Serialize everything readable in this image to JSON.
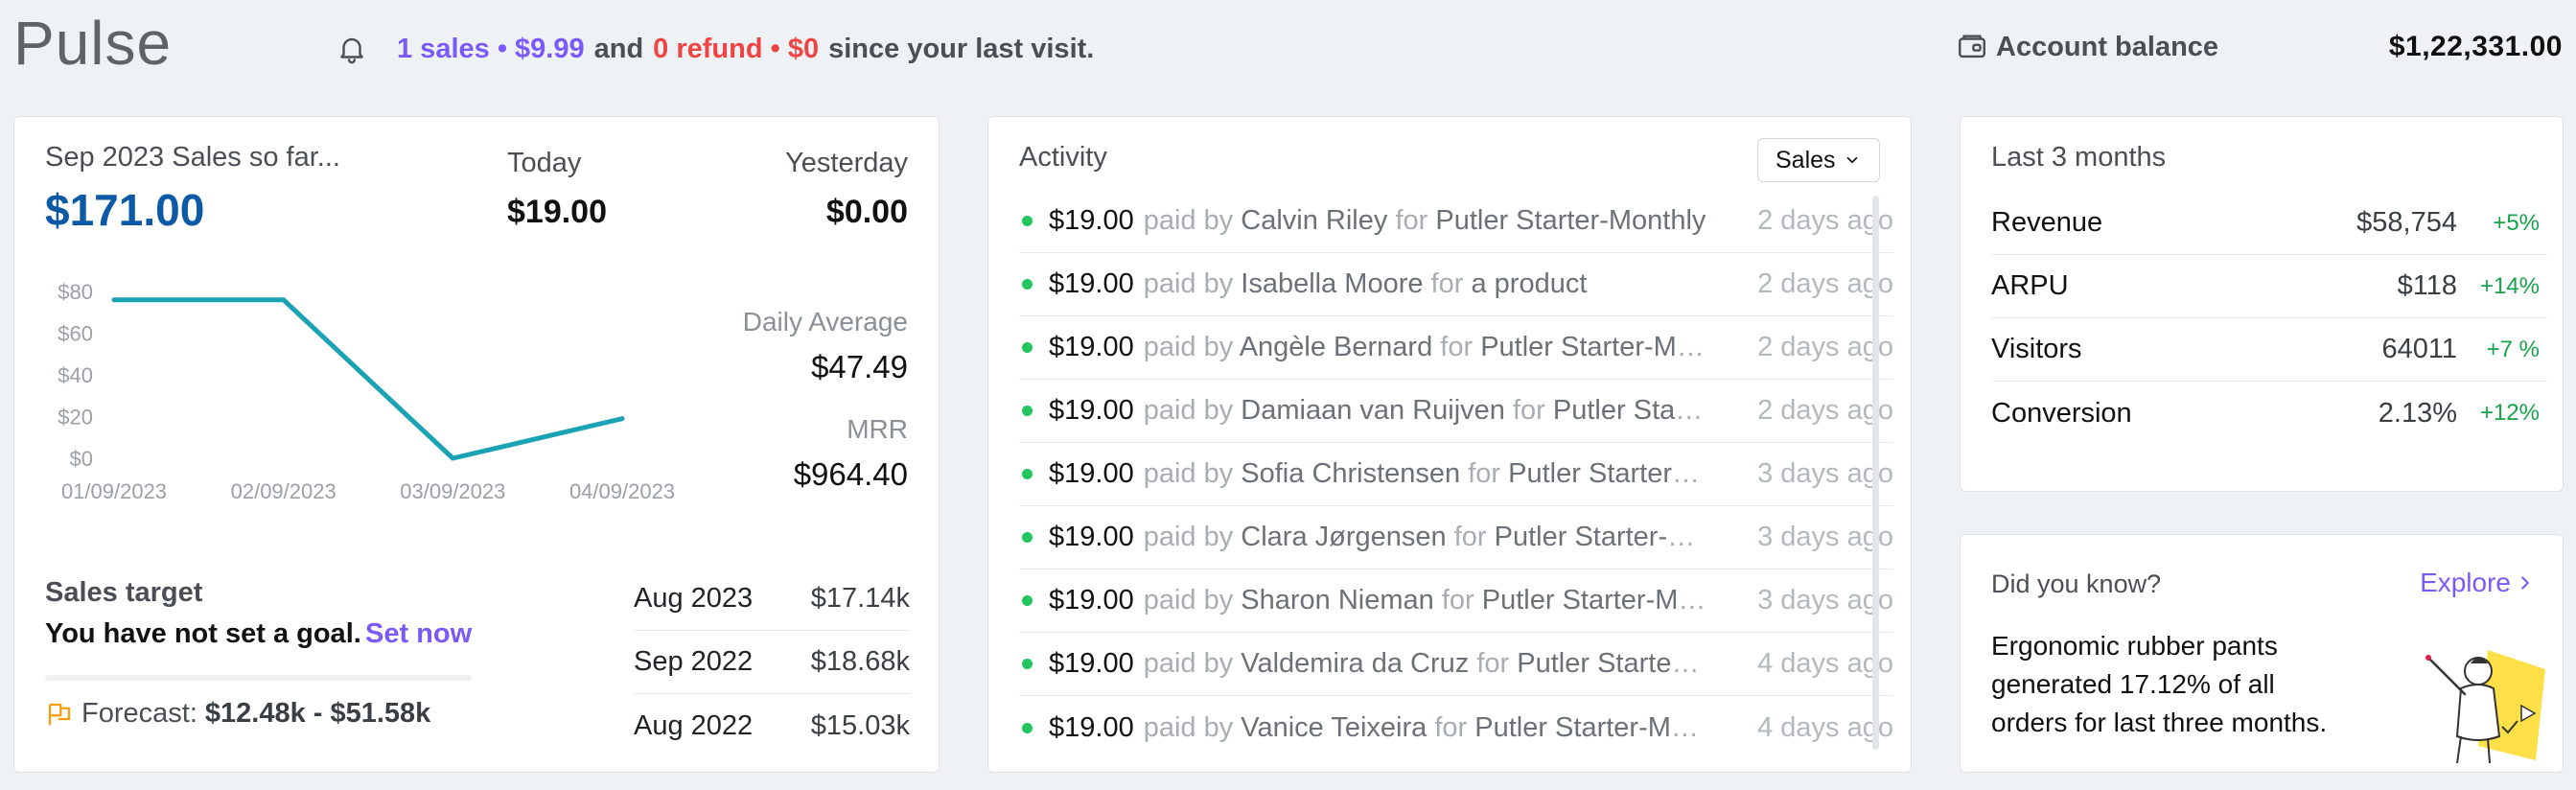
{
  "app": {
    "title": "Pulse"
  },
  "notice": {
    "sales": "1 sales • $9.99",
    "and": "and",
    "refund": "0 refund • $0",
    "since": "since your last visit.",
    "icon": "bell-icon"
  },
  "account": {
    "label": "Account balance",
    "value": "$1,22,331.00",
    "icon": "wallet-icon"
  },
  "sales_card": {
    "title": "Sep 2023 Sales so far...",
    "total": "$171.00",
    "today_label": "Today",
    "today_value": "$19.00",
    "yesterday_label": "Yesterday",
    "yesterday_value": "$0.00",
    "daily_avg_label": "Daily Average",
    "daily_avg_value": "$47.49",
    "mrr_label": "MRR",
    "mrr_value": "$964.40",
    "target_title": "Sales target",
    "target_text": "You have not set a goal.",
    "target_link": "Set now",
    "forecast_label": "Forecast:",
    "forecast_value": "$12.48k - $51.58k",
    "history": [
      {
        "period": "Aug 2023",
        "value": "$17.14k"
      },
      {
        "period": "Sep 2022",
        "value": "$18.68k"
      },
      {
        "period": "Aug 2022",
        "value": "$15.03k"
      }
    ],
    "line_color": "#1aa3b5"
  },
  "chart_data": {
    "type": "line",
    "x": [
      "01/09/2023",
      "02/09/2023",
      "03/09/2023",
      "04/09/2023"
    ],
    "series": [
      {
        "values": [
          76,
          76,
          0,
          19
        ]
      }
    ],
    "y_ticks": [
      "$0",
      "$20",
      "$40",
      "$60",
      "$80"
    ],
    "ylim": [
      0,
      80
    ],
    "grid": false,
    "title": "",
    "xlabel": "",
    "ylabel": ""
  },
  "activity": {
    "title": "Activity",
    "filter": "Sales",
    "paid_by": "paid by",
    "for": "for",
    "items": [
      {
        "amount": "$19.00",
        "customer": "Calvin Riley",
        "product": "Putler Starter-Monthly",
        "time": "2 days ago"
      },
      {
        "amount": "$19.00",
        "customer": "Isabella Moore",
        "product": "a product",
        "time": "2 days ago"
      },
      {
        "amount": "$19.00",
        "customer": "Angèle Bernard",
        "product": "Putler Starter-Monthly",
        "time": "2 days ago"
      },
      {
        "amount": "$19.00",
        "customer": "Damiaan van Ruijven",
        "product": "Putler Starter-Monthly",
        "time": "2 days ago"
      },
      {
        "amount": "$19.00",
        "customer": "Sofia Christensen",
        "product": "Putler Starter-Monthly",
        "time": "3 days ago"
      },
      {
        "amount": "$19.00",
        "customer": "Clara Jørgensen",
        "product": "Putler Starter-Monthly",
        "time": "3 days ago"
      },
      {
        "amount": "$19.00",
        "customer": "Sharon Nieman",
        "product": "Putler Starter-Monthly",
        "time": "3 days ago"
      },
      {
        "amount": "$19.00",
        "customer": "Valdemira da Cruz",
        "product": "Putler Starter-Monthly",
        "time": "4 days ago"
      },
      {
        "amount": "$19.00",
        "customer": "Vanice Teixeira",
        "product": "Putler Starter-Monthly",
        "time": "4 days ago"
      }
    ]
  },
  "months": {
    "title": "Last 3 months",
    "rows": [
      {
        "name": "Revenue",
        "value": "$58,754",
        "change": "+5%"
      },
      {
        "name": "ARPU",
        "value": "$118",
        "change": "+14%"
      },
      {
        "name": "Visitors",
        "value": "64011",
        "change": "+7 %"
      },
      {
        "name": "Conversion",
        "value": "2.13%",
        "change": "+12%"
      }
    ]
  },
  "dyk": {
    "title": "Did you know?",
    "link": "Explore",
    "line1": "Ergonomic rubber pants",
    "line2": "generated 17.12% of all",
    "line3": "orders for last three months."
  }
}
